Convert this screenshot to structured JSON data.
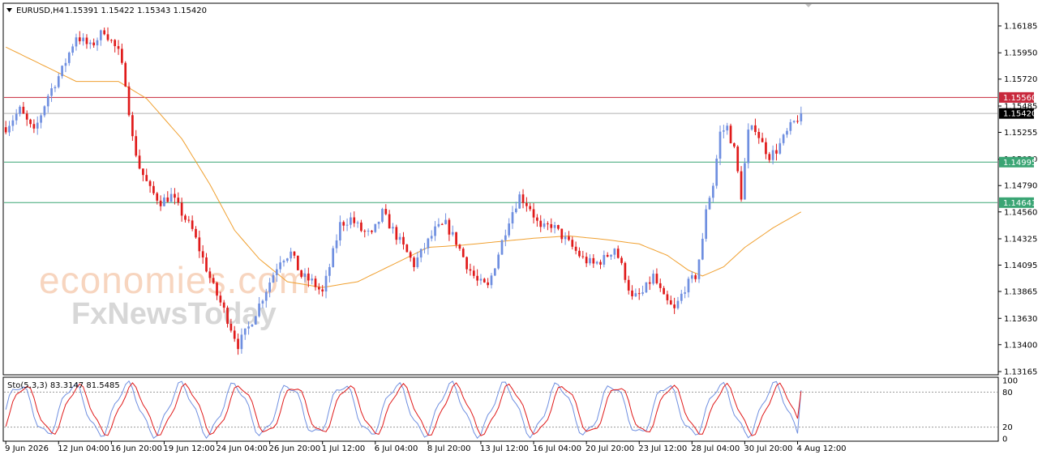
{
  "header": {
    "symbol": "EURUSD,H4",
    "ohlc": "1.15391 1.15422 1.15343 1.15420",
    "menu_icon": "triangle-down-icon"
  },
  "watermark": {
    "line1": "economies.com",
    "line2": "FxNewsToday"
  },
  "colors": {
    "bull": "#6f8fe0",
    "bear": "#e01a1a",
    "ma": "#f0a030",
    "resistance_line": "#c8283c",
    "support_line": "#3aa574",
    "price_line": "#b0b0b0",
    "stoch_main": "#6f8fe0",
    "stoch_signal": "#e01a1a"
  },
  "price_tags": [
    {
      "label": "1.15560",
      "value": 1.1556,
      "color": "#c8283c",
      "kind": "resistance"
    },
    {
      "label": "1.15420",
      "value": 1.1542,
      "color": "#000000",
      "kind": "current"
    },
    {
      "label": "1.14995",
      "value": 1.14995,
      "color": "#3aa574",
      "kind": "support"
    },
    {
      "label": "1.14641",
      "value": 1.14641,
      "color": "#3aa574",
      "kind": "support"
    }
  ],
  "stochastic": {
    "label": "Sto(5,3,3) 83.3147 81.5485",
    "levels": [
      "100",
      "80",
      "20",
      "0"
    ],
    "level_values": [
      100,
      80,
      20,
      0
    ]
  },
  "chart_data": {
    "type": "candlestick",
    "symbol": "EURUSD",
    "timeframe": "H4",
    "ylim": [
      1.13165,
      1.16185
    ],
    "y_ticks": [
      "1.16185",
      "1.15950",
      "1.15720",
      "1.15485",
      "1.15255",
      "1.15020",
      "1.14790",
      "1.14560",
      "1.14325",
      "1.14095",
      "1.13865",
      "1.13630",
      "1.13400",
      "1.13165"
    ],
    "x_ticks": [
      {
        "label": "9 Jun 2026",
        "index": 0
      },
      {
        "label": "12 Jun 04:00",
        "index": 15
      },
      {
        "label": "16 Jun 20:00",
        "index": 30
      },
      {
        "label": "19 Jun 12:00",
        "index": 45
      },
      {
        "label": "24 Jun 04:00",
        "index": 60
      },
      {
        "label": "26 Jun 20:00",
        "index": 75
      },
      {
        "label": "1 Jul 12:00",
        "index": 90
      },
      {
        "label": "6 Jul 04:00",
        "index": 105
      },
      {
        "label": "8 Jul 20:00",
        "index": 120
      },
      {
        "label": "13 Jul 12:00",
        "index": 135
      },
      {
        "label": "16 Jul 04:00",
        "index": 150
      },
      {
        "label": "20 Jul 20:00",
        "index": 165
      },
      {
        "label": "23 Jul 12:00",
        "index": 180
      },
      {
        "label": "28 Jul 04:00",
        "index": 195
      },
      {
        "label": "30 Jul 20:00",
        "index": 210
      },
      {
        "label": "4 Aug 12:00",
        "index": 225
      }
    ],
    "candle_anchors": [
      [
        0,
        1.153
      ],
      [
        4,
        1.1545
      ],
      [
        8,
        1.1525
      ],
      [
        12,
        1.1558
      ],
      [
        16,
        1.158
      ],
      [
        20,
        1.161
      ],
      [
        24,
        1.16
      ],
      [
        28,
        1.1615
      ],
      [
        32,
        1.1595
      ],
      [
        34,
        1.157
      ],
      [
        36,
        1.152
      ],
      [
        38,
        1.1495
      ],
      [
        41,
        1.1475
      ],
      [
        44,
        1.1465
      ],
      [
        47,
        1.147
      ],
      [
        50,
        1.1455
      ],
      [
        53,
        1.144
      ],
      [
        56,
        1.1415
      ],
      [
        59,
        1.139
      ],
      [
        62,
        1.137
      ],
      [
        64,
        1.1355
      ],
      [
        66,
        1.134
      ],
      [
        69,
        1.1355
      ],
      [
        72,
        1.1375
      ],
      [
        75,
        1.1395
      ],
      [
        78,
        1.1415
      ],
      [
        81,
        1.142
      ],
      [
        84,
        1.14
      ],
      [
        87,
        1.1395
      ],
      [
        90,
        1.1385
      ],
      [
        93,
        1.142
      ],
      [
        95,
        1.1445
      ],
      [
        98,
        1.145
      ],
      [
        101,
        1.144
      ],
      [
        104,
        1.1435
      ],
      [
        107,
        1.1455
      ],
      [
        110,
        1.144
      ],
      [
        113,
        1.1425
      ],
      [
        116,
        1.141
      ],
      [
        119,
        1.1425
      ],
      [
        122,
        1.144
      ],
      [
        125,
        1.1445
      ],
      [
        128,
        1.143
      ],
      [
        131,
        1.141
      ],
      [
        134,
        1.1395
      ],
      [
        137,
        1.139
      ],
      [
        140,
        1.142
      ],
      [
        143,
        1.145
      ],
      [
        146,
        1.147
      ],
      [
        149,
        1.146
      ],
      [
        152,
        1.144
      ],
      [
        155,
        1.1445
      ],
      [
        158,
        1.1435
      ],
      [
        161,
        1.1425
      ],
      [
        164,
        1.1415
      ],
      [
        167,
        1.141
      ],
      [
        170,
        1.1415
      ],
      [
        173,
        1.1425
      ],
      [
        176,
        1.14
      ],
      [
        178,
        1.138
      ],
      [
        181,
        1.1385
      ],
      [
        184,
        1.14
      ],
      [
        187,
        1.138
      ],
      [
        190,
        1.137
      ],
      [
        193,
        1.139
      ],
      [
        196,
        1.14
      ],
      [
        198,
        1.143
      ],
      [
        199,
        1.146
      ],
      [
        201,
        1.148
      ],
      [
        203,
        1.1525
      ],
      [
        205,
        1.153
      ],
      [
        207,
        1.151
      ],
      [
        209,
        1.147
      ],
      [
        211,
        1.1525
      ],
      [
        213,
        1.153
      ],
      [
        215,
        1.1515
      ],
      [
        217,
        1.1505
      ],
      [
        219,
        1.151
      ],
      [
        221,
        1.152
      ],
      [
        223,
        1.153
      ],
      [
        225,
        1.1538
      ],
      [
        226,
        1.1542
      ]
    ],
    "ma_curve": [
      [
        0,
        1.16
      ],
      [
        20,
        1.157
      ],
      [
        32,
        1.157
      ],
      [
        40,
        1.1555
      ],
      [
        50,
        1.152
      ],
      [
        58,
        1.148
      ],
      [
        65,
        1.144
      ],
      [
        72,
        1.1415
      ],
      [
        80,
        1.1395
      ],
      [
        90,
        1.139
      ],
      [
        100,
        1.1395
      ],
      [
        110,
        1.141
      ],
      [
        120,
        1.1425
      ],
      [
        130,
        1.1427
      ],
      [
        140,
        1.143
      ],
      [
        150,
        1.1433
      ],
      [
        160,
        1.1435
      ],
      [
        170,
        1.1432
      ],
      [
        180,
        1.1428
      ],
      [
        188,
        1.1418
      ],
      [
        194,
        1.1405
      ],
      [
        198,
        1.14
      ],
      [
        204,
        1.1408
      ],
      [
        210,
        1.1425
      ],
      [
        218,
        1.1442
      ],
      [
        226,
        1.1456
      ]
    ]
  }
}
